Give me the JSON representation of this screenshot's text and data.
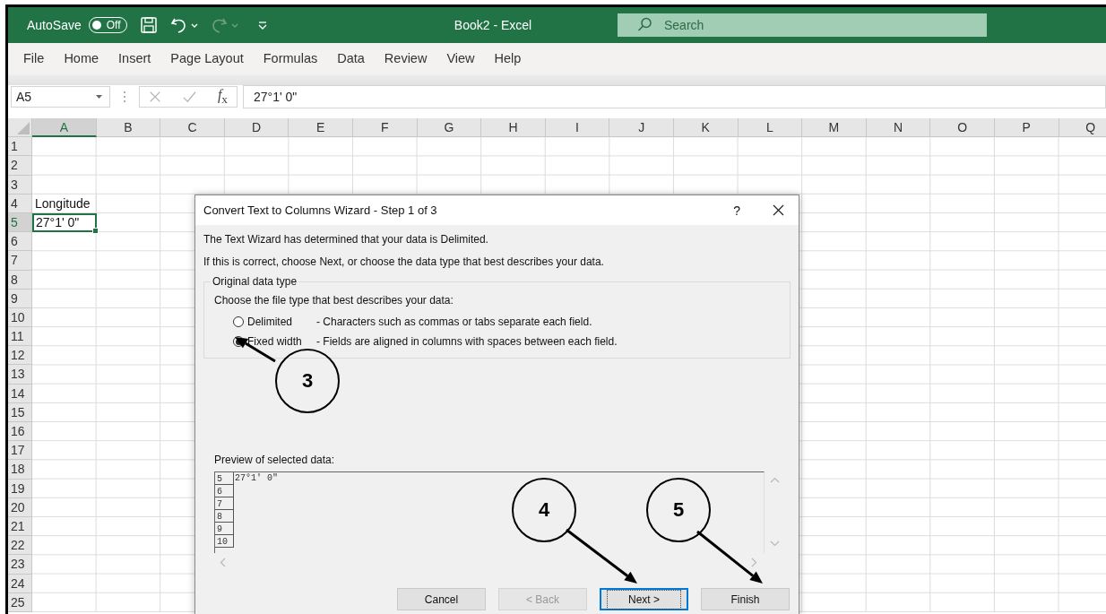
{
  "title_bar": {
    "autosave_label": "AutoSave",
    "autosave_toggle": {
      "on": false,
      "label": "Off"
    },
    "title": "Book2  -  Excel",
    "search": {
      "placeholder": "Search"
    }
  },
  "ribbon_tabs": [
    "File",
    "Home",
    "Insert",
    "Page Layout",
    "Formulas",
    "Data",
    "Review",
    "View",
    "Help"
  ],
  "formula_bar": {
    "name_box": "A5",
    "function_label": "*f*$_{x}$",
    "value": "27°1' 0\""
  },
  "grid": {
    "columns": [
      {
        "label": "A",
        "selected": true
      },
      {
        "label": "B",
        "selected": false
      },
      {
        "label": "C",
        "selected": false
      },
      {
        "label": "D",
        "selected": false
      },
      {
        "label": "E",
        "selected": false
      },
      {
        "label": "F",
        "selected": false
      },
      {
        "label": "G",
        "selected": false
      },
      {
        "label": "H",
        "selected": false
      },
      {
        "label": "I",
        "selected": false
      },
      {
        "label": "J",
        "selected": false
      },
      {
        "label": "K",
        "selected": false
      },
      {
        "label": "L",
        "selected": false
      },
      {
        "label": "M",
        "selected": false
      },
      {
        "label": "N",
        "selected": false
      },
      {
        "label": "O",
        "selected": false
      },
      {
        "label": "P",
        "selected": false
      },
      {
        "label": "Q",
        "selected": false
      }
    ],
    "rows": [
      {
        "label": "1",
        "selected": false
      },
      {
        "label": "2",
        "selected": false
      },
      {
        "label": "3",
        "selected": false
      },
      {
        "label": "4",
        "selected": false,
        "cells": [
          "Longitude"
        ]
      },
      {
        "label": "5",
        "selected": true,
        "cells": [
          "27°1' 0\""
        ]
      },
      {
        "label": "6",
        "selected": false
      },
      {
        "label": "7",
        "selected": false
      },
      {
        "label": "8",
        "selected": false
      },
      {
        "label": "9",
        "selected": false
      },
      {
        "label": "10",
        "selected": false
      },
      {
        "label": "11",
        "selected": false
      },
      {
        "label": "12",
        "selected": false
      },
      {
        "label": "13",
        "selected": false
      },
      {
        "label": "14",
        "selected": false
      },
      {
        "label": "15",
        "selected": false
      },
      {
        "label": "16",
        "selected": false
      },
      {
        "label": "17",
        "selected": false
      },
      {
        "label": "18",
        "selected": false
      },
      {
        "label": "19",
        "selected": false
      },
      {
        "label": "20",
        "selected": false
      },
      {
        "label": "21",
        "selected": false
      },
      {
        "label": "22",
        "selected": false
      },
      {
        "label": "23",
        "selected": false
      },
      {
        "label": "24",
        "selected": false
      },
      {
        "label": "25",
        "selected": false
      }
    ]
  },
  "dialog": {
    "title": "Convert Text to Columns Wizard - Step 1 of 3",
    "help": "?",
    "messages": [
      "The Text Wizard has determined that your data is Delimited.",
      "If this is correct, choose Next, or choose the data type that best describes your data."
    ],
    "group_title": "Original data type",
    "prompt": "Choose the file type that best describes your data:",
    "options": [
      {
        "label": "Delimited",
        "description": "- Characters such as commas or tabs separate each field.",
        "selected": false
      },
      {
        "label": "Fixed width",
        "description": "- Fields are aligned in columns with spaces between each field.",
        "selected": true
      }
    ],
    "preview_label": "Preview of selected data:",
    "preview_rows": [
      {
        "number": "5",
        "text": "27°1' 0\""
      },
      {
        "number": "6"
      },
      {
        "number": "7"
      },
      {
        "number": "8"
      },
      {
        "number": "9"
      },
      {
        "number": "10"
      }
    ],
    "buttons": [
      {
        "label": "Cancel",
        "disabled": false,
        "focused": false
      },
      {
        "label": "< Back",
        "disabled": true,
        "focused": false
      },
      {
        "label": "Next >",
        "disabled": false,
        "focused": true
      },
      {
        "label": "Finish",
        "disabled": false,
        "focused": false
      }
    ]
  },
  "callouts": [
    {
      "label": "3"
    },
    {
      "label": "4"
    },
    {
      "label": "5"
    }
  ]
}
